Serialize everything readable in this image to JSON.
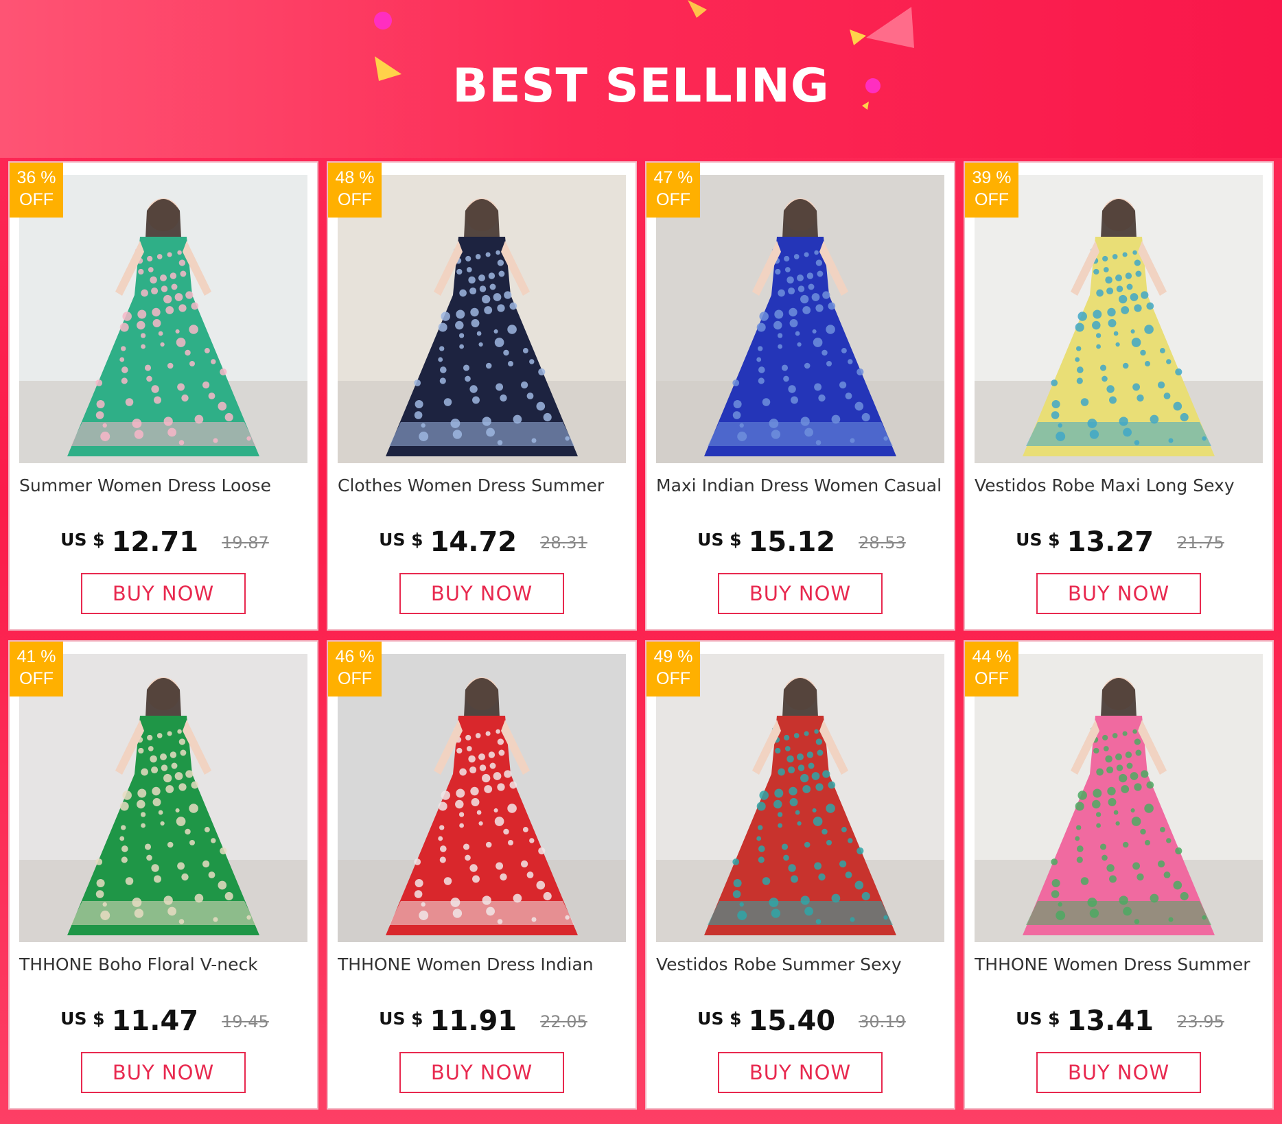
{
  "header": {
    "title": "BEST SELLING"
  },
  "colors": {
    "accent": "#e8294f",
    "badge": "#ffb000",
    "background": "#fb1c4a"
  },
  "cards": [
    {
      "discount": "36 %",
      "off": "OFF",
      "title": "Summer Women Dress Loose",
      "currency": "US $",
      "price": "12.71",
      "original": "19.87",
      "button": "BUY NOW",
      "dress_color": "#2faf87",
      "accent_color": "#f7b7c8"
    },
    {
      "discount": "48 %",
      "off": "OFF",
      "title": "Clothes Women Dress Summer",
      "currency": "US $",
      "price": "14.72",
      "original": "28.31",
      "button": "BUY NOW",
      "dress_color": "#1d2340",
      "accent_color": "#9db6e0"
    },
    {
      "discount": "47 %",
      "off": "OFF",
      "title": "Maxi Indian Dress Women Casual",
      "currency": "US $",
      "price": "15.12",
      "original": "28.53",
      "button": "BUY NOW",
      "dress_color": "#2435b8",
      "accent_color": "#6f8fdc"
    },
    {
      "discount": "39 %",
      "off": "OFF",
      "title": "Vestidos Robe Maxi Long Sexy",
      "currency": "US $",
      "price": "13.27",
      "original": "21.75",
      "button": "BUY NOW",
      "dress_color": "#e9de76",
      "accent_color": "#3fa7c8"
    },
    {
      "discount": "41 %",
      "off": "OFF",
      "title": "THHONE Boho Floral V-neck",
      "currency": "US $",
      "price": "11.47",
      "original": "19.45",
      "button": "BUY NOW",
      "dress_color": "#1f9647",
      "accent_color": "#e7dcc2"
    },
    {
      "discount": "46 %",
      "off": "OFF",
      "title": "THHONE Women Dress Indian",
      "currency": "US $",
      "price": "11.91",
      "original": "22.05",
      "button": "BUY NOW",
      "dress_color": "#d9272c",
      "accent_color": "#f1e6e8"
    },
    {
      "discount": "49 %",
      "off": "OFF",
      "title": "Vestidos Robe Summer Sexy",
      "currency": "US $",
      "price": "15.40",
      "original": "30.19",
      "button": "BUY NOW",
      "dress_color": "#c8332d",
      "accent_color": "#2fa6a8"
    },
    {
      "discount": "44 %",
      "off": "OFF",
      "title": "THHONE Women Dress Summer",
      "currency": "US $",
      "price": "13.41",
      "original": "23.95",
      "button": "BUY NOW",
      "dress_color": "#f06aa0",
      "accent_color": "#4caa62"
    }
  ]
}
